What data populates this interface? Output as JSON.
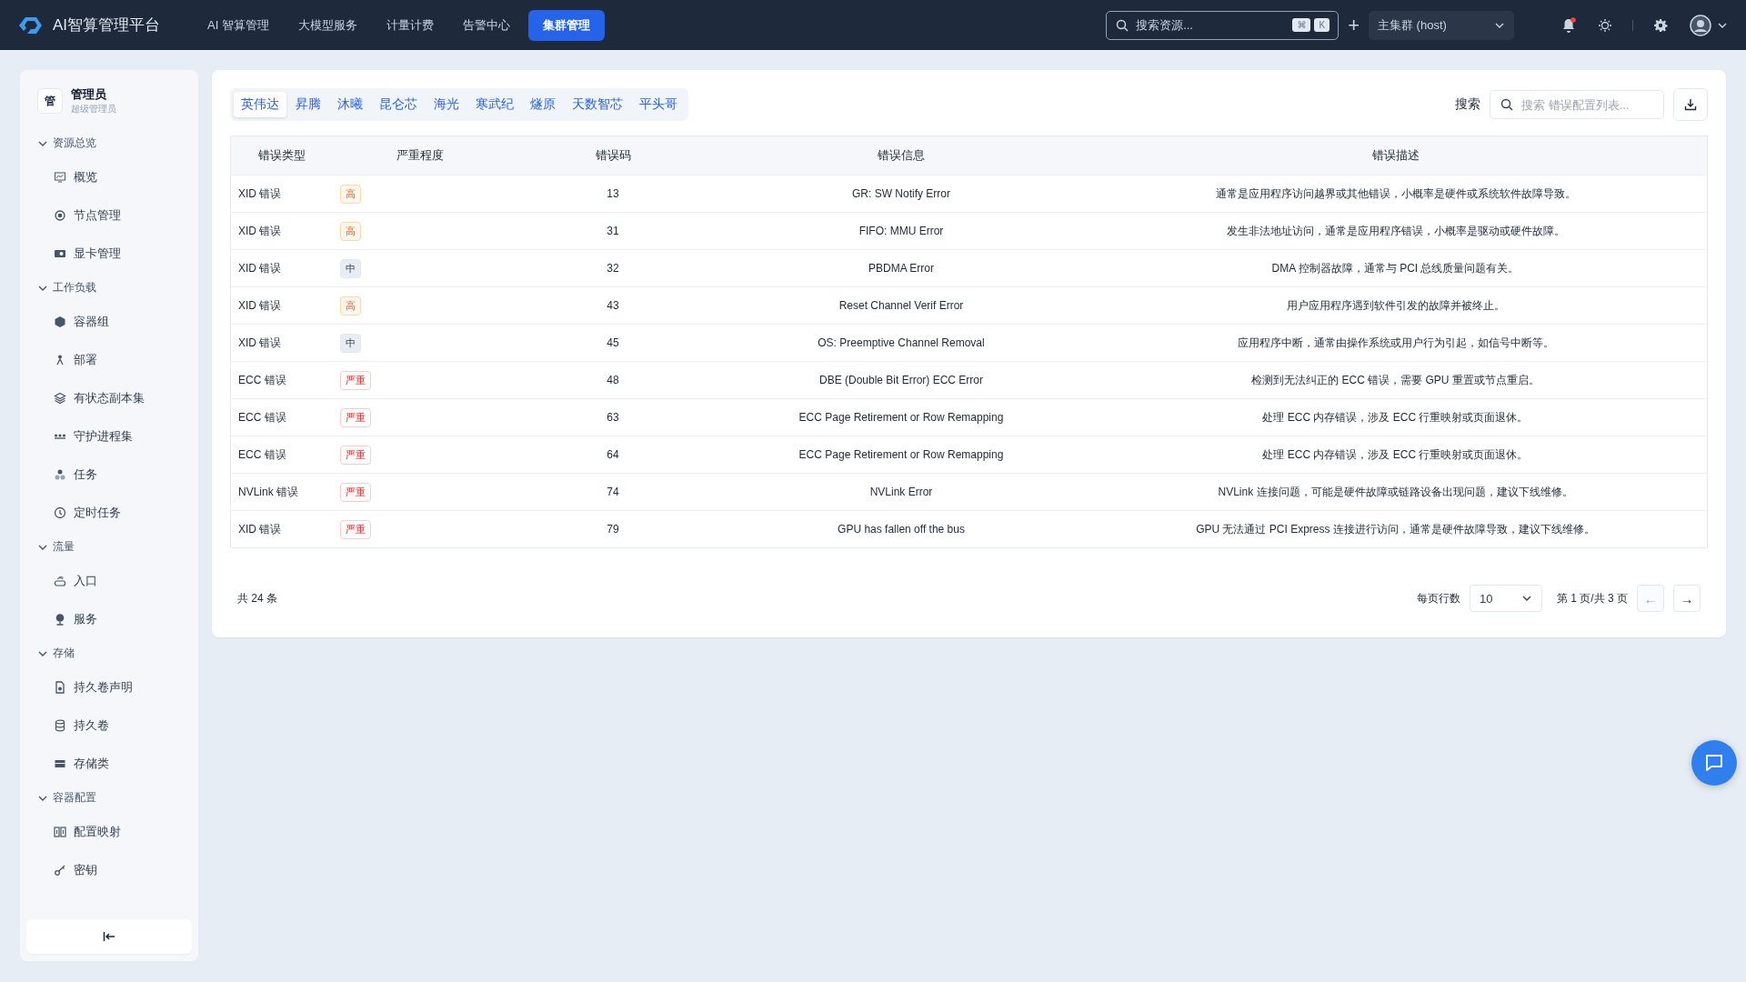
{
  "topbar": {
    "logo_text": "AI智算管理平台",
    "nav": [
      {
        "label": "AI 智算管理",
        "selected": false
      },
      {
        "label": "大模型服务",
        "selected": false
      },
      {
        "label": "计量计费",
        "selected": false
      },
      {
        "label": "告警中心",
        "selected": false
      },
      {
        "label": "集群管理",
        "selected": true
      }
    ],
    "search": {
      "placeholder": "搜索资源...",
      "keys": [
        "⌘",
        "K"
      ]
    },
    "add": "+",
    "cluster_select": "主集群 (host)",
    "notification_dot": true
  },
  "sidebar": {
    "user": {
      "avatar": "管",
      "name": "管理员",
      "role": "超级管理员"
    },
    "sections": [
      {
        "title": "资源总览",
        "expanded": true,
        "items": [
          "概览",
          "节点管理",
          "显卡管理"
        ]
      },
      {
        "title": "工作负载",
        "expanded": true,
        "items": [
          "容器组",
          "部署",
          "有状态副本集",
          "守护进程集",
          "任务",
          "定时任务"
        ]
      },
      {
        "title": "流量",
        "expanded": true,
        "items": [
          "入口",
          "服务"
        ]
      },
      {
        "title": "存储",
        "expanded": true,
        "items": [
          "持久卷声明",
          "持久卷",
          "存储类"
        ]
      },
      {
        "title": "容器配置",
        "expanded": true,
        "items": [
          "配置映射",
          "密钥"
        ]
      }
    ]
  },
  "main": {
    "vendor_tabs": [
      {
        "label": "英伟达",
        "selected": true
      },
      {
        "label": "昇腾",
        "selected": false
      },
      {
        "label": "沐曦",
        "selected": false
      },
      {
        "label": "昆仑芯",
        "selected": false
      },
      {
        "label": "海光",
        "selected": false
      },
      {
        "label": "寒武纪",
        "selected": false
      },
      {
        "label": "燧原",
        "selected": false
      },
      {
        "label": "天数智芯",
        "selected": false
      },
      {
        "label": "平头哥",
        "selected": false
      }
    ],
    "search_label": "搜索",
    "search": {
      "placeholder": "搜索 错误配置列表..."
    },
    "table": {
      "columns": [
        "错误类型",
        "严重程度",
        "错误码",
        "错误信息",
        "错误描述"
      ],
      "rows": [
        {
          "type": "XID 错误",
          "severity": "高",
          "kind": "high",
          "code": "13",
          "message": "GR: SW Notify Error",
          "description": "通常是应用程序访问越界或其他错误，小概率是硬件或系统软件故障导致。"
        },
        {
          "type": "XID 错误",
          "severity": "高",
          "kind": "high",
          "code": "31",
          "message": "FIFO: MMU Error",
          "description": "发生非法地址访问，通常是应用程序错误，小概率是驱动或硬件故障。"
        },
        {
          "type": "XID 错误",
          "severity": "中",
          "kind": "medium",
          "code": "32",
          "message": "PBDMA Error",
          "description": "DMA 控制器故障，通常与 PCI 总线质量问题有关。"
        },
        {
          "type": "XID 错误",
          "severity": "高",
          "kind": "high",
          "code": "43",
          "message": "Reset Channel Verif Error",
          "description": "用户应用程序遇到软件引发的故障并被终止。"
        },
        {
          "type": "XID 错误",
          "severity": "中",
          "kind": "medium",
          "code": "45",
          "message": "OS: Preemptive Channel Removal",
          "description": "应用程序中断，通常由操作系统或用户行为引起，如信号中断等。"
        },
        {
          "type": "ECC 错误",
          "severity": "严重",
          "kind": "critical",
          "code": "48",
          "message": "DBE (Double Bit Error) ECC Error",
          "description": "检测到无法纠正的 ECC 错误，需要 GPU 重置或节点重启。"
        },
        {
          "type": "ECC 错误",
          "severity": "严重",
          "kind": "critical",
          "code": "63",
          "message": "ECC Page Retirement or Row Remapping",
          "description": "处理 ECC 内存错误，涉及 ECC 行重映射或页面退休。"
        },
        {
          "type": "ECC 错误",
          "severity": "严重",
          "kind": "critical",
          "code": "64",
          "message": "ECC Page Retirement or Row Remapping",
          "description": "处理 ECC 内存错误，涉及 ECC 行重映射或页面退休。"
        },
        {
          "type": "NVLink 错误",
          "severity": "严重",
          "kind": "critical",
          "code": "74",
          "message": "NVLink Error",
          "description": "NVLink 连接问题，可能是硬件故障或链路设备出现问题，建议下线维修。"
        },
        {
          "type": "XID 错误",
          "severity": "严重",
          "kind": "critical",
          "code": "79",
          "message": "GPU has fallen off the bus",
          "description": "GPU 无法通过 PCI Express 连接进行访问，通常是硬件故障导致，建议下线维修。"
        }
      ]
    },
    "pagination": {
      "total": "共 24 条",
      "rows_label": "每页行数",
      "page_size": "10",
      "page_info": "第 1 页/共 3 页",
      "prev": {
        "label": "←",
        "disabled": true
      },
      "next": {
        "label": "→",
        "disabled": false
      }
    }
  }
}
